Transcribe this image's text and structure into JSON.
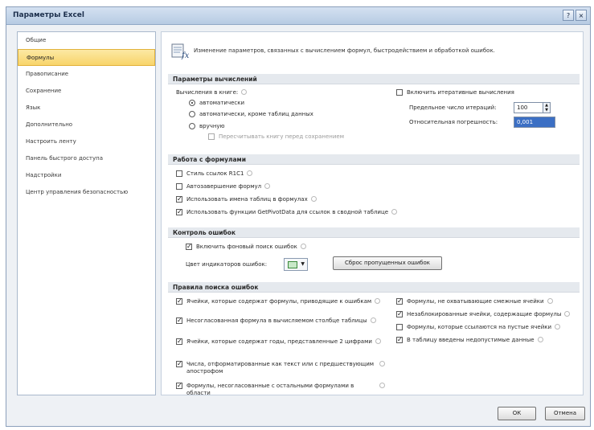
{
  "window": {
    "title": "Параметры Excel",
    "help": "?",
    "close": "×"
  },
  "sidebar": {
    "items": [
      {
        "label": "Общие",
        "active": false
      },
      {
        "label": "Формулы",
        "active": true
      },
      {
        "label": "Правописание",
        "active": false
      },
      {
        "label": "Сохранение",
        "active": false
      },
      {
        "label": "Язык",
        "active": false
      },
      {
        "label": "Дополнительно",
        "active": false
      },
      {
        "label": "Настроить ленту",
        "active": false
      },
      {
        "label": "Панель быстрого доступа",
        "active": false
      },
      {
        "label": "Надстройки",
        "active": false
      },
      {
        "label": "Центр управления безопасностью",
        "active": false
      }
    ]
  },
  "intro": {
    "icon": "formula-settings-icon",
    "text": "Изменение параметров, связанных с вычислением формул, быстродействием и обработкой ошибок."
  },
  "calc": {
    "header": "Параметры вычислений",
    "workbook_label": "Вычисления в книге:",
    "auto": "автоматически",
    "auto_except": "автоматически, кроме таблиц данных",
    "manual": "вручную",
    "recalc_before_save": "Пересчитывать книгу перед сохранением",
    "iterative": "Включить итеративные вычисления",
    "max_iterations_label": "Предельное число итераций:",
    "max_iterations_value": "100",
    "max_change_label": "Относительная погрешность:",
    "max_change_value": "0,001",
    "selected_mode": "auto"
  },
  "formulas": {
    "header": "Работа с формулами",
    "items": [
      {
        "label": "Стиль ссылок R1C1",
        "checked": false
      },
      {
        "label": "Автозавершение формул",
        "checked": false
      },
      {
        "label": "Использовать имена таблиц в формулах",
        "checked": true
      },
      {
        "label": "Использовать функции GetPivotData для ссылок в сводной таблице",
        "checked": true
      }
    ]
  },
  "error_check": {
    "header": "Контроль ошибок",
    "enable": "Включить фоновый поиск ошибок",
    "enable_checked": true,
    "color_label": "Цвет индикаторов ошибок:",
    "reset_button": "Сброс пропущенных ошибок"
  },
  "rules": {
    "header": "Правила поиска ошибок",
    "left": [
      {
        "label": "Ячейки, которые содержат формулы, приводящие к ошибкам",
        "checked": true
      },
      {
        "label": "Несогласованная формула в вычисляемом столбце таблицы",
        "checked": true
      },
      {
        "label": "Ячейки, которые содержат годы, представленные 2 цифрами",
        "checked": true
      },
      {
        "label": "Числа, отформатированные как текст или с предшествующим апострофом",
        "checked": true
      },
      {
        "label": "Формулы, несогласованные с остальными формулами в области",
        "checked": true
      }
    ],
    "right": [
      {
        "label": "Формулы, не охватывающие смежные ячейки",
        "checked": true
      },
      {
        "label": "Незаблокированные ячейки, содержащие формулы",
        "checked": true
      },
      {
        "label": "Формулы, которые ссылаются на пустые ячейки",
        "checked": false
      },
      {
        "label": "В таблицу введены недопустимые данные",
        "checked": true
      }
    ]
  },
  "footer": {
    "ok": "ОК",
    "cancel": "Отмена"
  }
}
